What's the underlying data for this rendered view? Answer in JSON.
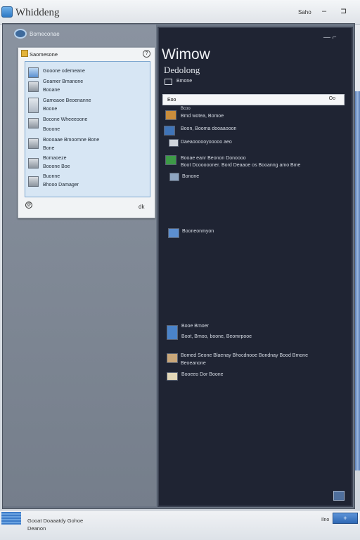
{
  "window": {
    "title": "Whiddeng",
    "controls": {
      "save_label": "Saho",
      "minimize_icon": "minimize-icon",
      "restore_icon": "restore-icon"
    }
  },
  "left_panel": {
    "header_label": "Bomeconae"
  },
  "dialog": {
    "title": "Saomesone",
    "help_glyph": "?",
    "items": [
      {
        "icon": "window-icon",
        "lines": [
          "Gooone odemeane"
        ]
      },
      {
        "icon": "picture-icon",
        "lines": [
          "Goamer Bmanone",
          "Booane"
        ]
      },
      {
        "icon": "document-icon",
        "lines": [
          "Gamoaoe Beoenanne",
          "Boone"
        ]
      },
      {
        "icon": "monitor-icon",
        "lines": [
          "Bocone Wheeeoone",
          "Booone"
        ]
      },
      {
        "icon": "drive-icon",
        "lines": [
          "Boooaae Bmoomne Bone",
          "Bone"
        ]
      },
      {
        "icon": "computer-icon",
        "lines": [
          "Bomaoeze",
          "Booone Boe"
        ]
      },
      {
        "icon": "display-icon",
        "lines": [
          "Buonne",
          "Bhooo Damager"
        ]
      }
    ],
    "footer_left": "@",
    "footer_right": "dk"
  },
  "right_panel": {
    "menu_glyph": "— ⌐",
    "title": "Wimow",
    "subtitle": "Dedolong",
    "tab_label": "Bmone",
    "search": {
      "value": "Eoo",
      "placeholder": "",
      "action_label": "Oo"
    },
    "items": [
      {
        "icon": "folder-icon",
        "color": "#c98d3c",
        "lines": [
          "Bmd wotea, Bomoe"
        ],
        "top_line": "Bcoo"
      },
      {
        "icon": "globe-icon",
        "color": "#3f74b8",
        "lines": [
          "Boon, Booma dooaaooon"
        ]
      },
      {
        "icon": "camera-icon",
        "color": "#cfd4db",
        "lines": [
          "Daeaoooooyooooo aeo"
        ]
      },
      {
        "icon": "green-app-icon",
        "color": "#3d9a47",
        "lines": [
          "Booae eanr Beonon Donoooo",
          "Boot Dcoooooner. Bord Deaaoe os Booanng amo Bme"
        ]
      },
      {
        "icon": "image-icon",
        "color": "#8fa6c2",
        "lines": [
          "Bonone"
        ]
      },
      {
        "icon": "settings-icon",
        "color": "#5c8fd1",
        "lines": [
          "Booneonmyon"
        ]
      },
      {
        "icon": "network-icon",
        "color": "#4a83c9",
        "lines": [
          "Booe Bmoer",
          "Boot, Bmoo, boone, Beomrpooe"
        ]
      },
      {
        "icon": "archive-icon",
        "color": "#c9a77a",
        "lines": [
          "Bomed Seone Blaenay Bhocdnooe Bondnay Bood Bmone",
          "Beoeanone"
        ]
      },
      {
        "icon": "file-icon",
        "color": "#e2d7b8",
        "lines": [
          "Booeeo Dor Boone"
        ]
      }
    ]
  },
  "statusbar": {
    "line1": "Gooat Doaaatdy Gohoe",
    "line2": "Deanon",
    "right_label": "Ilno",
    "right_button": "+"
  },
  "colors": {
    "frame": "#6b7584",
    "right_panel_bg": "#1f2433",
    "dialog_list_bg": "#d7e6f4",
    "accent": "#2f68b4"
  }
}
